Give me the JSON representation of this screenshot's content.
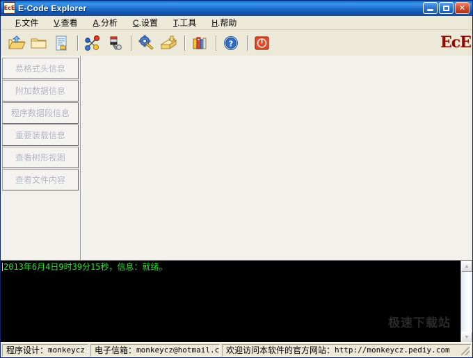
{
  "window": {
    "title": "E-Code Explorer",
    "icon": "ece-logo-icon",
    "buttons": {
      "minimize": "minimize-button",
      "maximize": "maximize-button",
      "close_glyph": "✕"
    }
  },
  "menubar": {
    "items": [
      {
        "accel": "F",
        "label": ".文件"
      },
      {
        "accel": "V",
        "label": ".查看"
      },
      {
        "accel": "A",
        "label": ".分析"
      },
      {
        "accel": "C",
        "label": ".设置"
      },
      {
        "accel": "T",
        "label": ".工具"
      },
      {
        "accel": "H",
        "label": ".帮助"
      }
    ]
  },
  "toolbar": {
    "buttons": [
      {
        "name": "open-file-icon"
      },
      {
        "name": "open-folder-icon"
      },
      {
        "name": "document-properties-icon"
      },
      {
        "name": "analyze-icon"
      },
      {
        "name": "magnet-inspect-icon"
      },
      {
        "name": "gear-settings-icon"
      },
      {
        "name": "export-package-icon"
      },
      {
        "name": "library-books-icon"
      },
      {
        "name": "help-icon"
      },
      {
        "name": "exit-icon"
      }
    ],
    "logo_text": "EcE"
  },
  "sidebar": {
    "buttons": [
      {
        "label": "易格式头信息",
        "name": "sidebar-item-format-header-info",
        "disabled": true
      },
      {
        "label": "附加数据信息",
        "name": "sidebar-item-attached-data-info",
        "disabled": true
      },
      {
        "label": "程序数据段信息",
        "name": "sidebar-item-program-data-segment-info",
        "disabled": true
      },
      {
        "label": "重要装载信息",
        "name": "sidebar-item-important-load-info",
        "disabled": true
      },
      {
        "label": "查看树形视图",
        "name": "sidebar-item-view-tree",
        "disabled": true
      },
      {
        "label": "查看文件内容",
        "name": "sidebar-item-view-file-content",
        "disabled": true
      }
    ]
  },
  "console": {
    "lines": [
      "2013年6月4日9时39分15秒，信息：就绪。"
    ],
    "watermark": "极速下载站",
    "scroll_up": "▲",
    "scroll_down": "▼"
  },
  "statusbar": {
    "author_label": "程序设计：",
    "author_value": "monkeycz",
    "email_label": "电子信箱：",
    "email_value": "monkeycz@hotmail.com",
    "site_label": "欢迎访问本软件的官方网站：",
    "site_value": "http://monkeycz.pediy.com"
  },
  "colors": {
    "title_gradient_start": "#0a5fc4",
    "title_gradient_end": "#21539f",
    "face": "#ece9d8",
    "console_bg": "#000000",
    "console_text": "#29e629",
    "logo": "#8c0b0b"
  }
}
